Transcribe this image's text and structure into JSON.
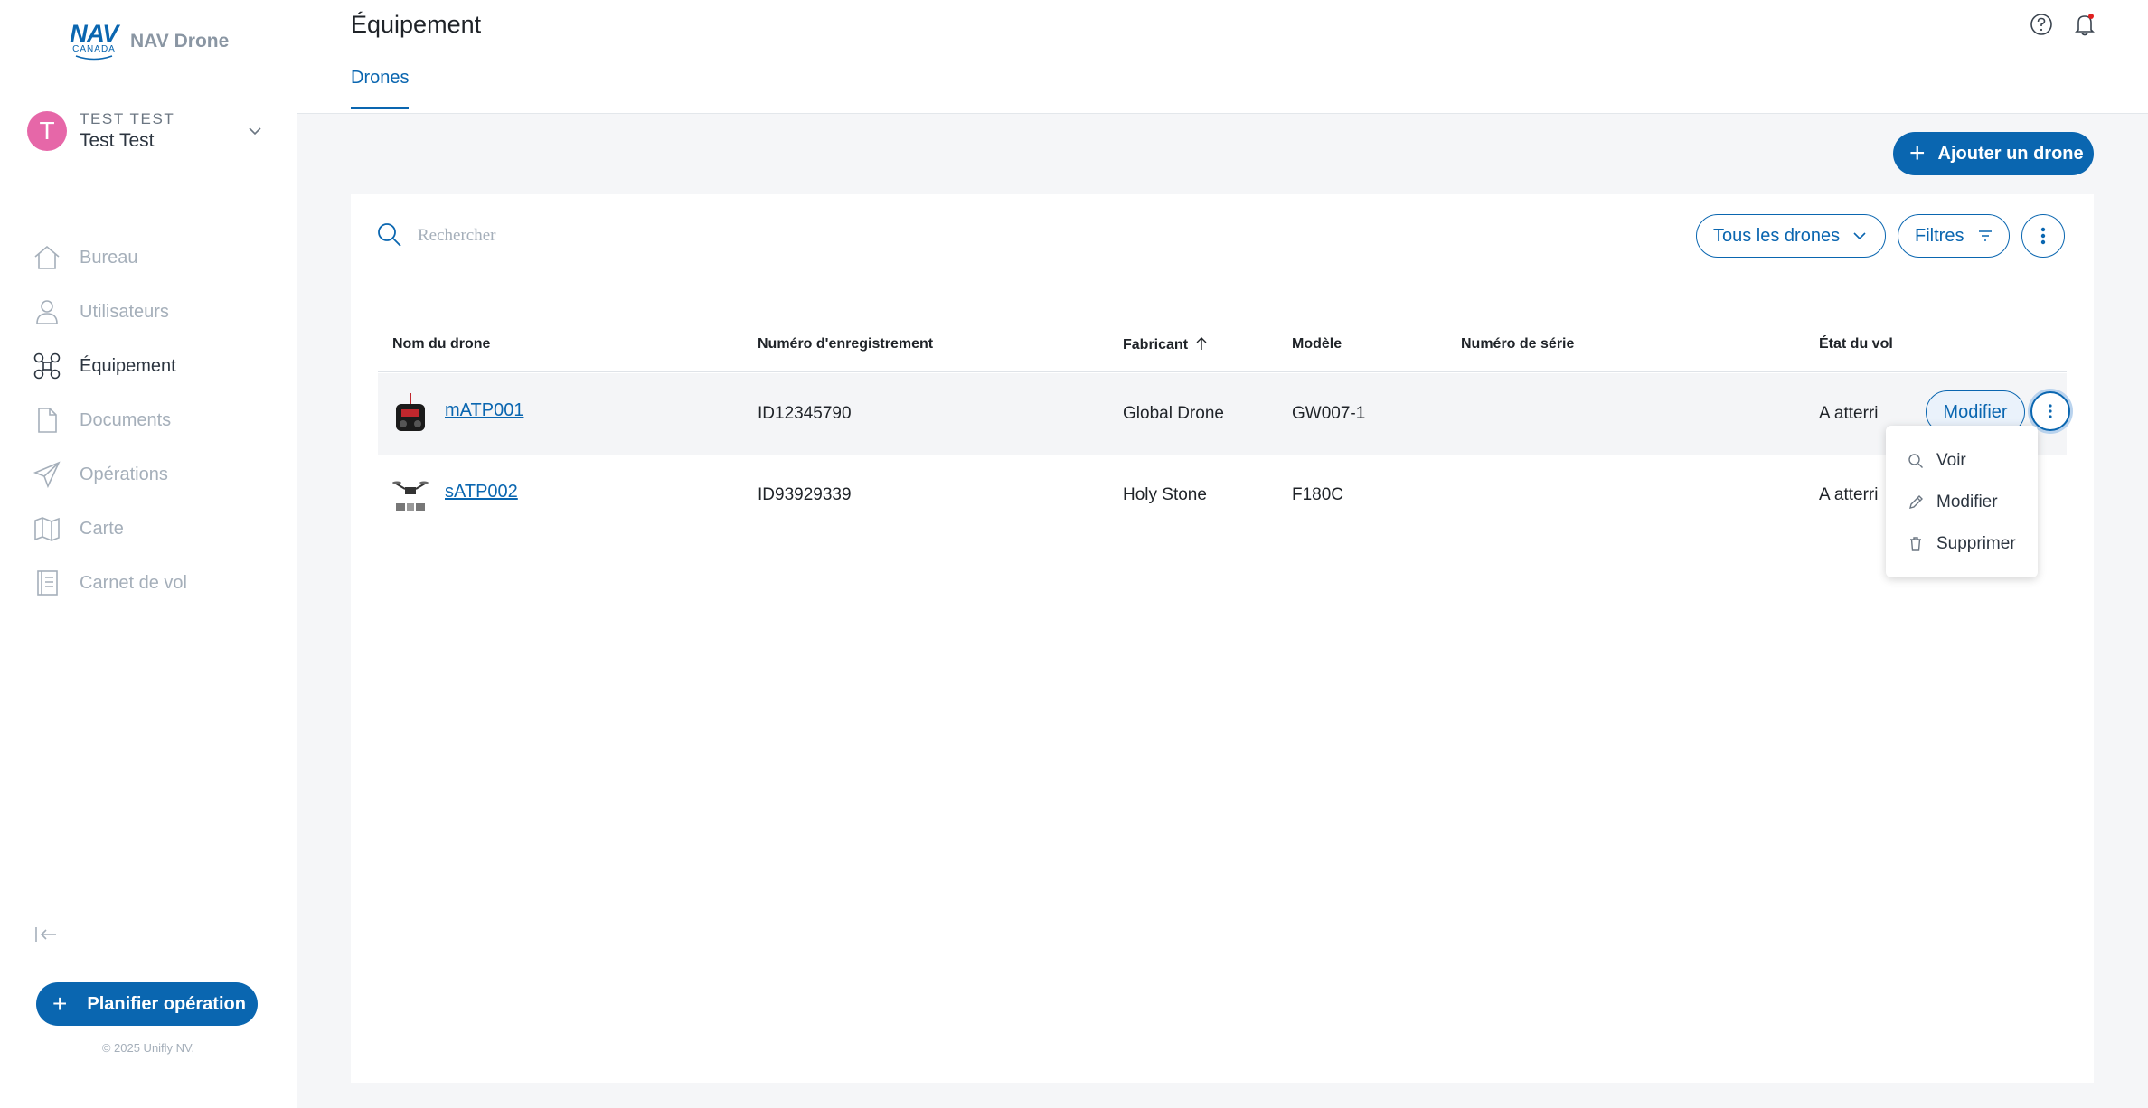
{
  "sidebar": {
    "logo": {
      "mark_top": "NAV",
      "mark_bottom": "CANADA",
      "app_name": "NAV Drone"
    },
    "user": {
      "initial": "T",
      "org": "TEST TEST",
      "name": "Test Test"
    },
    "menu": [
      {
        "label": "Bureau",
        "icon": "home-icon"
      },
      {
        "label": "Utilisateurs",
        "icon": "user-icon"
      },
      {
        "label": "Équipement",
        "icon": "drone-icon",
        "active": true
      },
      {
        "label": "Documents",
        "icon": "document-icon"
      },
      {
        "label": "Opérations",
        "icon": "paper-plane-icon"
      },
      {
        "label": "Carte",
        "icon": "map-icon"
      },
      {
        "label": "Carnet de vol",
        "icon": "logbook-icon"
      }
    ],
    "plan_button": "Planifier opération",
    "copyright": "© 2025 Unifly NV."
  },
  "header": {
    "title": "Équipement",
    "tabs": [
      {
        "label": "Drones",
        "active": true
      }
    ]
  },
  "toolbar": {
    "add_button": "Ajouter un drone",
    "search_placeholder": "Rechercher",
    "all_drones": "Tous les drones",
    "filters": "Filtres"
  },
  "table": {
    "columns": [
      "Nom du drone",
      "Numéro d'enregistrement",
      "Fabricant",
      "Modèle",
      "Numéro de série",
      "État du vol"
    ],
    "sort_column": "Fabricant",
    "rows": [
      {
        "name": "mATP001",
        "registration": "ID12345790",
        "manufacturer": "Global Drone",
        "model": "GW007-1",
        "serial": "",
        "status": "A atterri",
        "action": "Modifier"
      },
      {
        "name": "sATP002",
        "registration": "ID93929339",
        "manufacturer": "Holy Stone",
        "model": "F180C",
        "serial": "",
        "status": "A atterri"
      }
    ]
  },
  "row_menu": {
    "items": [
      {
        "label": "Voir",
        "icon": "search-icon"
      },
      {
        "label": "Modifier",
        "icon": "pencil-icon"
      },
      {
        "label": "Supprimer",
        "icon": "trash-icon"
      }
    ]
  },
  "colors": {
    "primary": "#0a66b0",
    "avatar": "#e667a8",
    "notification_dot": "#e02020"
  }
}
